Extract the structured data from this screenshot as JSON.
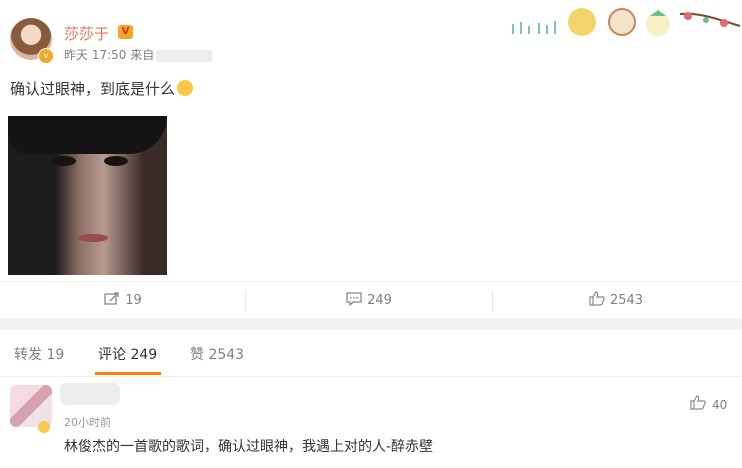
{
  "post": {
    "username": "莎莎于",
    "vip_badge": "V",
    "verified_badge": "v",
    "time": "昨天 17:50",
    "source_prefix": "来自",
    "text": "确认过眼神，到底是什么",
    "actions": {
      "repost": "19",
      "comment": "249",
      "like": "2543"
    }
  },
  "tabs": [
    {
      "label": "转发 19"
    },
    {
      "label": "评论 249"
    },
    {
      "label": "赞 2543"
    }
  ],
  "comments": [
    {
      "time": "20小时前",
      "text": "林俊杰的一首歌的歌词，确认过眼神，我遇上对的人-醉赤壁",
      "likes": "40"
    }
  ],
  "colors": {
    "username": "#eb7350",
    "tab_active_underline": "#ff8200",
    "page_background": "#f2f2f5"
  },
  "icons": [
    "repost-icon",
    "comment-icon",
    "like-icon",
    "emoji-icon"
  ]
}
